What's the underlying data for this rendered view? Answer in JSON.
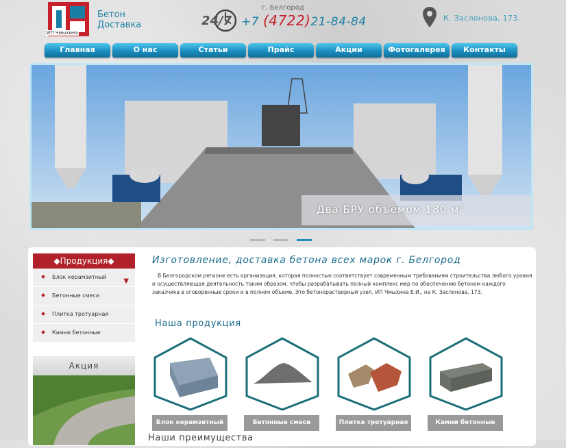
{
  "header": {
    "logo_brand": "Бетон",
    "logo_brand2": "Доставка",
    "logo_company": "ИП Чмыхина",
    "badge": "24/7",
    "city": "г. Белгород",
    "phone_prefix": "+7",
    "phone_code": "(4722)",
    "phone_number": "21-84-84",
    "address": "К. Заслонова, 173."
  },
  "nav": {
    "items": [
      "Главная",
      "О нас",
      "Статьи",
      "Прайс",
      "Акции",
      "Фотогалерея",
      "Контакты"
    ]
  },
  "slider": {
    "caption": "Два БРУ объёмом 180 м³",
    "active_dot": 3
  },
  "sidebar": {
    "title": "◆Продукция◆",
    "items": [
      "Блок керамзитный",
      "Бетонные смеси",
      "Плитка тротуарная",
      "Камни бетонные"
    ],
    "promo_title": "Акция"
  },
  "main": {
    "heading": "Изготовление, доставка бетона всех марок г. Белгород",
    "intro": "В Белгородском регионе есть организация, которая полностью соответствует современным требованиям строительства любого уровня и осуществляющая деятельность таким образом, чтобы разрабатывать полный комплекс мер по обеспечению бетоном каждого заказчика в оговоренные сроки и в полном объеме. Это бетонорастворный узел, ИП Чмыхина Е.И., на К. Заслонова, 173.",
    "products_title": "Наша продукция",
    "products": [
      {
        "label": "Блок керамзитный",
        "icon": "block-icon"
      },
      {
        "label": "Бетонные смеси",
        "icon": "sand-pile-icon"
      },
      {
        "label": "Плитка тротуарная",
        "icon": "paving-tile-icon"
      },
      {
        "label": "Камни бетонные",
        "icon": "curb-stone-icon"
      }
    ],
    "next_title": "Наши преимущества"
  },
  "colors": {
    "accent": "#1a8fc0",
    "brand_red": "#b02129",
    "link": "#1a6b8c"
  }
}
